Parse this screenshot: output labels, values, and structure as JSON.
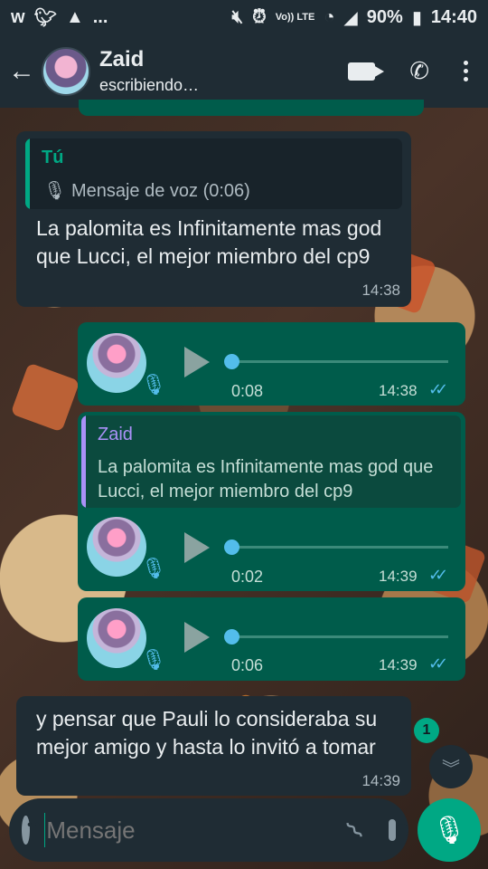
{
  "status_bar": {
    "left_icons": [
      "wallpaper-w-icon",
      "twitter-icon",
      "warning-icon"
    ],
    "ellipsis": "...",
    "volte": "Vo)) LTE",
    "battery": "90%",
    "time": "14:40"
  },
  "header": {
    "back": "←",
    "name": "Zaid",
    "status": "escribiendo…"
  },
  "messages": [
    {
      "direction": "in",
      "quote_author": "Tú",
      "quote_icon": "mic-icon",
      "quote_body": "Mensaje de voz (0:06)",
      "text": "La palomita es Infinitamente mas god que Lucci, el mejor miembro del cp9",
      "time": "14:38"
    },
    {
      "direction": "out",
      "type": "voice",
      "duration": "0:08",
      "time": "14:38",
      "ticks": "✓✓"
    },
    {
      "direction": "out",
      "type": "voice",
      "quote_author": "Zaid",
      "quote_body": "La palomita es Infinitamente mas god que Lucci, el mejor miembro del cp9",
      "duration": "0:02",
      "time": "14:39",
      "ticks": "✓✓"
    },
    {
      "direction": "out",
      "type": "voice",
      "duration": "0:06",
      "time": "14:39",
      "ticks": "✓✓"
    },
    {
      "direction": "in",
      "text": "y pensar que Pauli lo consideraba su mejor amigo y hasta lo invitó a tomar",
      "time": "14:39"
    }
  ],
  "unread_count": "1",
  "input": {
    "placeholder": "Mensaje"
  },
  "colors": {
    "incoming_bubble": "#1f2c34",
    "outgoing_bubble": "#005c4b",
    "accent": "#00a884",
    "tick_read": "#53bdeb",
    "quote_you": "#00a884",
    "quote_zaid": "#a991f7"
  }
}
